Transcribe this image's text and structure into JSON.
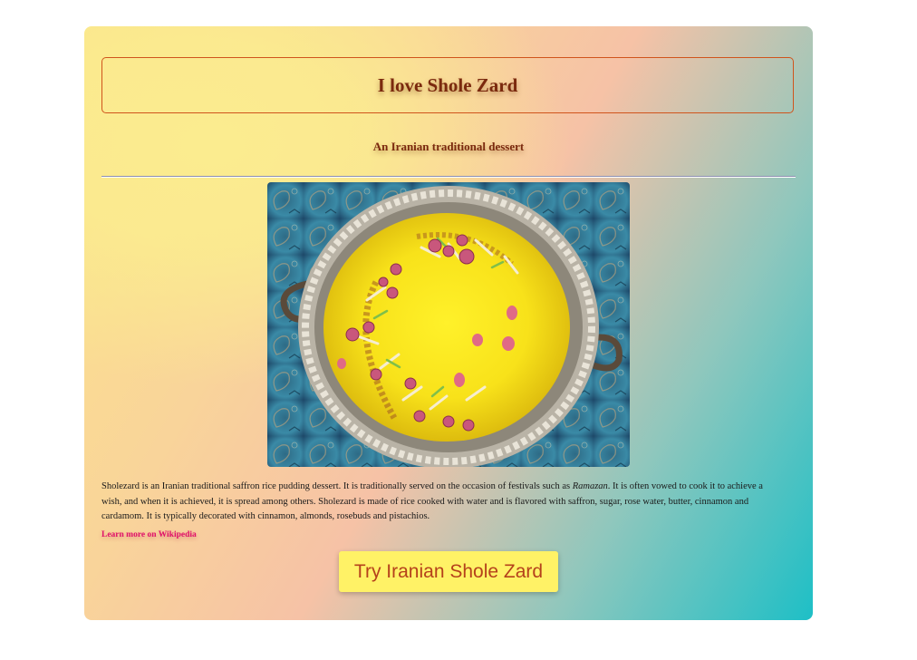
{
  "card": {
    "title": "I love Shole Zard",
    "subtitle": "An Iranian traditional dessert",
    "description": {
      "part1": "Sholezard is an Iranian traditional saffron rice pudding dessert. It is traditionally served on the occasion of festivals such as ",
      "emphasis": "Ramazan",
      "part2": ". It is often vowed to cook it to achieve a wish, and when it is achieved, it is spread among others. Sholezard is made of rice cooked with water and is flavored with saffron, sugar, rose water, butter, cinnamon and cardamom. It is typically decorated with cinnamon, almonds, rosebuds and pistachios."
    },
    "link_label": "Learn more on Wikipedia",
    "button_label": "Try Iranian Shole Zard",
    "photo_icon": "shole-zard-bowl-photo"
  },
  "colors": {
    "title_text": "#7b2a0e",
    "title_border": "#d0541c",
    "link": "#e0106a",
    "button_bg": "#fff266",
    "button_text": "#b5411b",
    "gradient_start": "#fbec8f",
    "gradient_mid": "#f6c2a6",
    "gradient_end": "#1ebfc6"
  }
}
